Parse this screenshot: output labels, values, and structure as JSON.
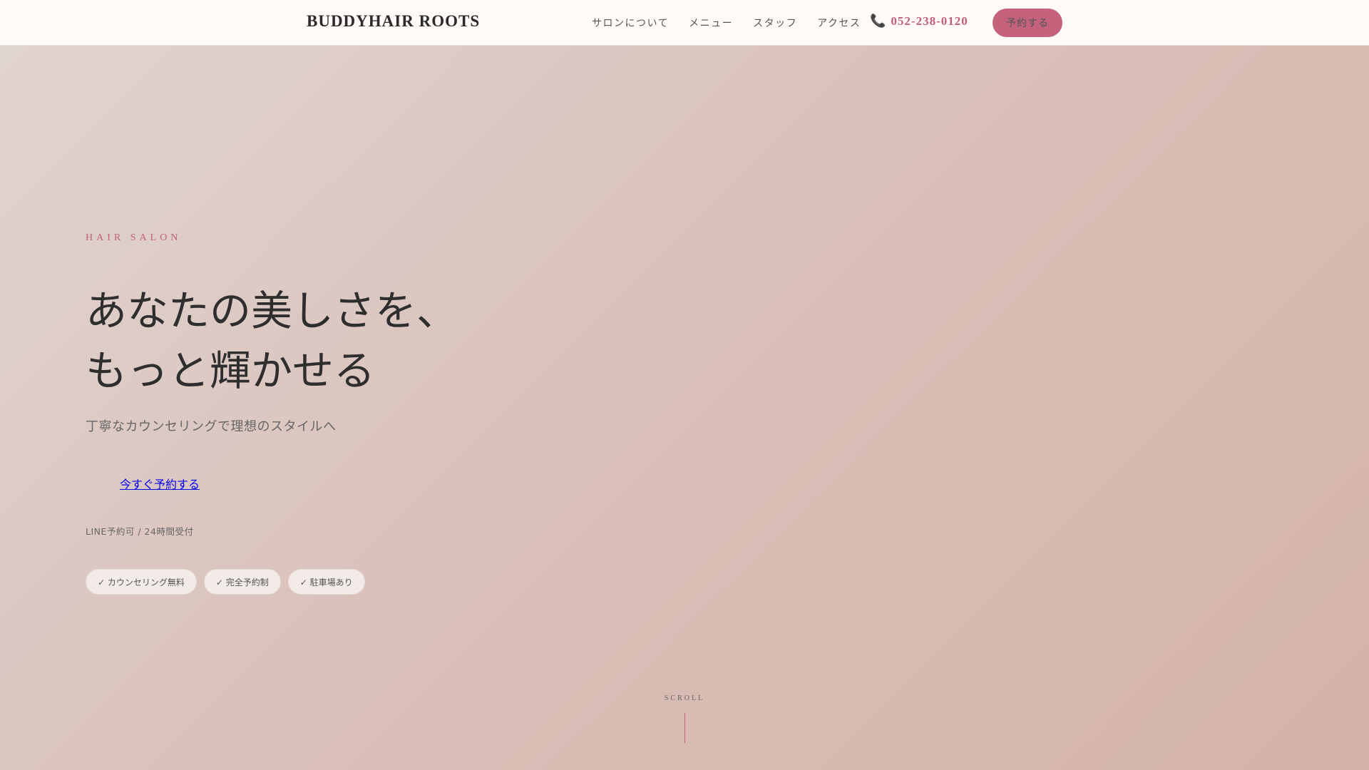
{
  "header": {
    "logo": "BUDDYHAIR ROOTS",
    "nav": [
      "サロンについて",
      "メニュー",
      "スタッフ",
      "アクセス"
    ],
    "phone": "052-238-0120",
    "reserve_label": "予約する"
  },
  "hero": {
    "eyebrow": "HAIR SALON",
    "headline_line1": "あなたの美しさを、",
    "headline_line2": "もっと輝かせる",
    "subtitle": "丁寧なカウンセリングで理想のスタイルへ",
    "cta": "今すぐ予約する",
    "note": "LINE予約可 / 24時間受付",
    "chips": [
      "✓ カウンセリング無料",
      "✓ 完全予約制",
      "✓ 駐車場あり"
    ],
    "scroll": "SCROLL"
  },
  "colors": {
    "accent": "#c3627a",
    "background": "#fffaf8"
  }
}
